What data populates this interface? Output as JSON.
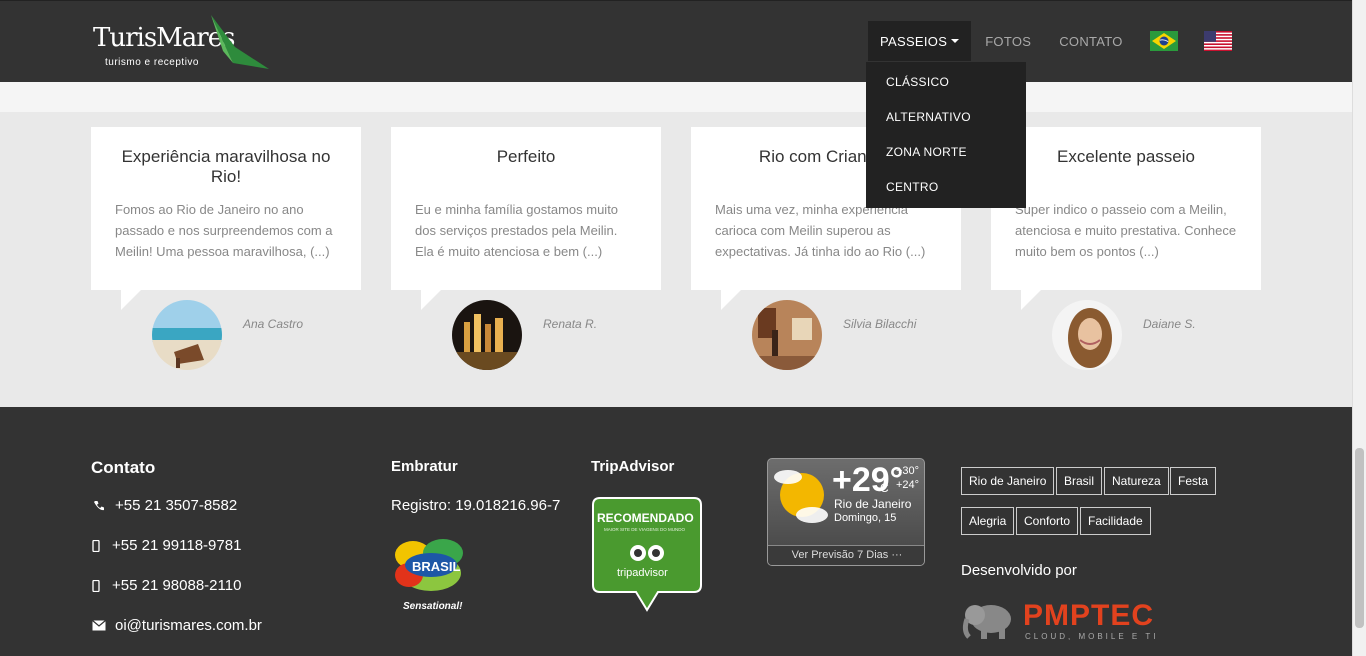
{
  "header": {
    "logo_name": "TurisMares",
    "logo_tagline": "turismo e receptivo",
    "nav": {
      "passeios": "PASSEIOS",
      "fotos": "FOTOS",
      "contato": "CONTATO"
    },
    "dropdown": [
      "CLÁSSICO",
      "ALTERNATIVO",
      "ZONA NORTE",
      "CENTRO"
    ]
  },
  "testimonials": [
    {
      "title": "Experiência maravilhosa no Rio!",
      "text": "Fomos ao Rio de Janeiro no ano passado e nos surpreendemos com a Meilin! Uma pessoa maravilhosa, (...)",
      "author": "Ana Castro"
    },
    {
      "title": "Perfeito",
      "text": "Eu e minha família gostamos muito dos serviços prestados pela Meilin. Ela é muito atenciosa e bem (...)",
      "author": "Renata R."
    },
    {
      "title": "Rio com Crianças",
      "text": "Mais uma vez, minha experiência carioca com Meilin superou as expectativas. Já tinha ido ao Rio (...)",
      "author": "Silvia Bilacchi"
    },
    {
      "title": "Excelente passeio",
      "text": "Super indico o passeio com a Meilin, atenciosa e muito prestativa. Conhece muito bem os pontos (...)",
      "author": "Daiane S."
    }
  ],
  "footer": {
    "contato_title": "Contato",
    "phone1": "+55 21 3507-8582",
    "phone2": "+55 21 99118-9781",
    "phone3": "+55 21 98088-2110",
    "email": "oi@turismares.com.br",
    "embratur_title": "Embratur",
    "embratur_registro": "Registro: 19.018216.96-7",
    "brasil_badge": "BRASIL",
    "brasil_slogan": "Sensational!",
    "tripadvisor_title": "TripAdvisor",
    "tripadvisor_badge": "RECOMENDADO",
    "tripadvisor_sub": "MAIOR SITE DE VIAGENS DO MUNDO",
    "tripadvisor_brand": "tripadvisor",
    "weather": {
      "temp": "+29°",
      "unit": "C",
      "max": "+30°",
      "min": "+24°",
      "city": "Rio de Janeiro",
      "day": "Domingo, 15",
      "link": "Ver Previsão 7 Dias"
    },
    "tags": [
      "Rio de Janeiro",
      "Brasil",
      "Natureza",
      "Festa",
      "Alegria",
      "Conforto",
      "Facilidade"
    ],
    "developed_by": "Desenvolvido por",
    "dev_brand": "PMPTEC",
    "dev_tagline": "CLOUD, MOBILE E TI"
  }
}
